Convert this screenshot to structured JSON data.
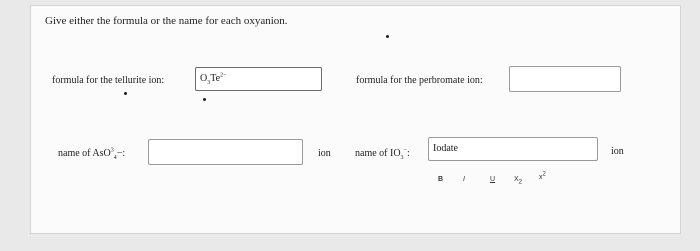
{
  "prompt": "Give either the formula or the name for each oxyanion.",
  "q1": {
    "label": "formula for the tellurite ion:",
    "value_base": "O",
    "value_sub": "3",
    "value_base2": "Te",
    "value_sup": "2−"
  },
  "q2": {
    "label": "formula for the perbromate ion:",
    "value": ""
  },
  "q3": {
    "label_prefix": "name of AsO",
    "label_sup": "3",
    "label_sub": "4",
    "label_suffix": "−:",
    "value": "",
    "unit": "ion"
  },
  "q4": {
    "label_prefix": "name of IO",
    "label_sub": "3",
    "label_sup": "−",
    "label_suffix": ":",
    "value": "Iodate",
    "unit": "ion"
  },
  "toolbar": {
    "bold": "B",
    "italic": "I",
    "underline": "U",
    "subscript_base": "X",
    "subscript_sub": "2",
    "superscript_base": "x",
    "superscript_sup": "2"
  }
}
